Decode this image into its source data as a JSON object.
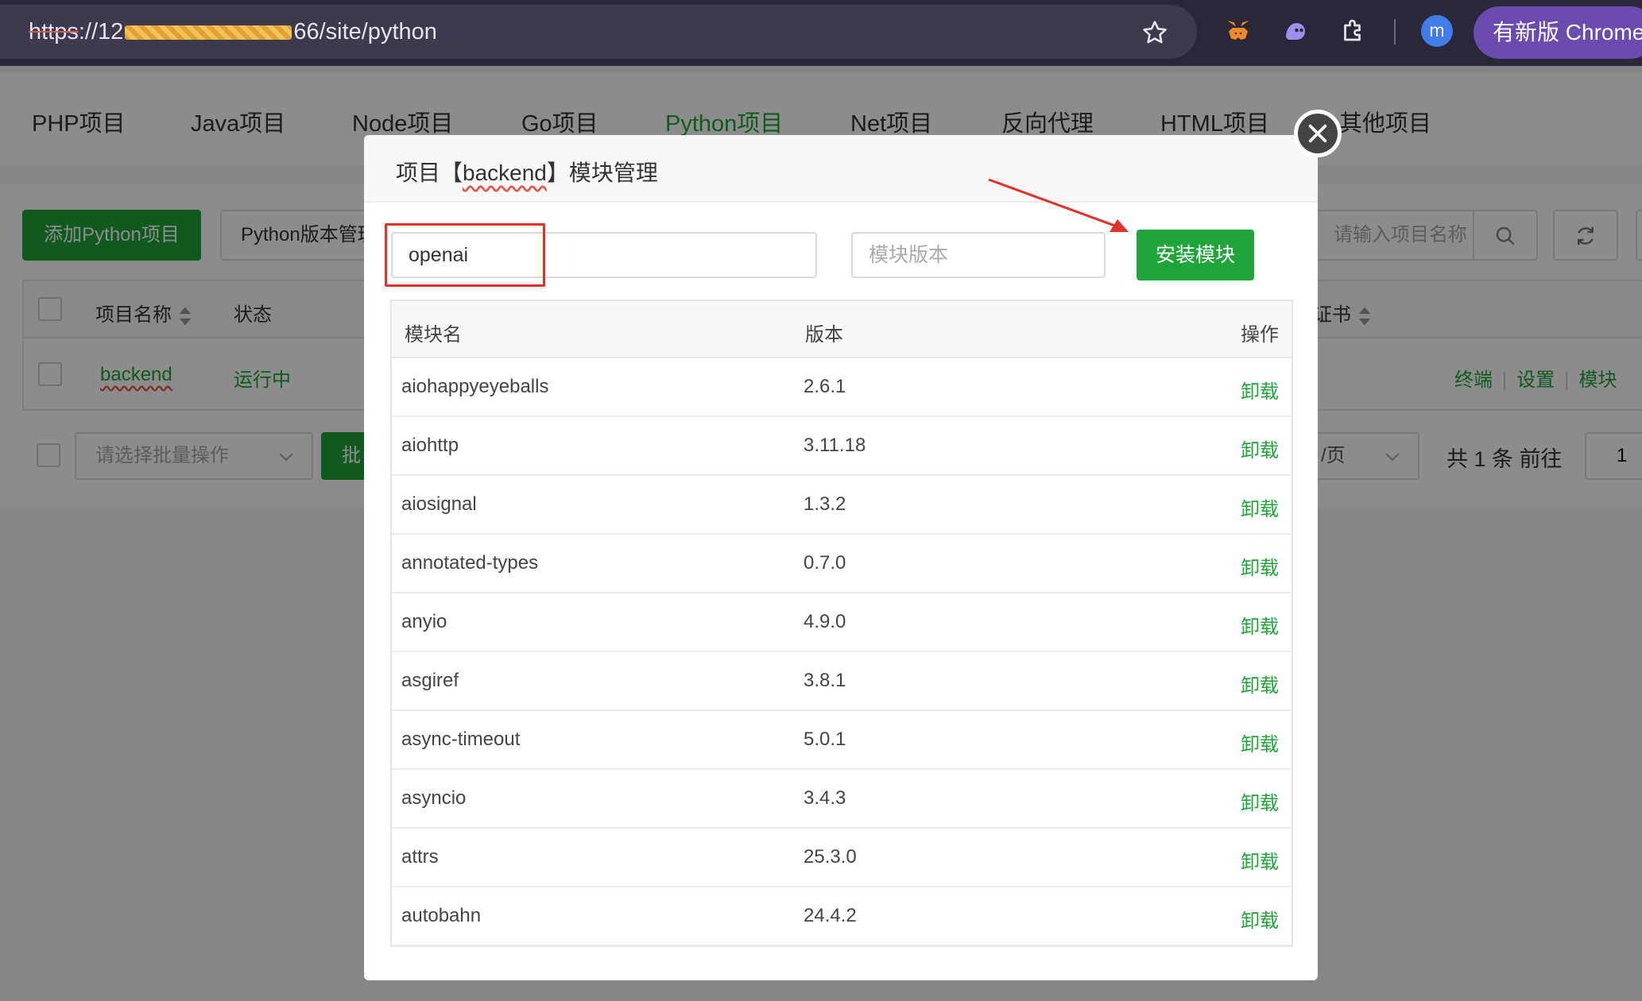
{
  "browser": {
    "url_scheme": "https",
    "url_prefix": "://12",
    "url_suffix": "66/site/python",
    "update_label": "有新版 Chrome",
    "avatar_letter": "m"
  },
  "app": {
    "tabs": [
      "PHP项目",
      "Java项目",
      "Node项目",
      "Go项目",
      "Python项目",
      "Net项目",
      "反向代理",
      "HTML项目",
      "其他项目"
    ],
    "active_tab": "Python项目",
    "add_button": "添加Python项目",
    "pyver_button": "Python版本管理",
    "search_placeholder": "请输入项目名称",
    "table": {
      "col_name": "项目名称",
      "col_status": "状态",
      "col_cert": "证书",
      "row_name": "backend",
      "row_status": "运行中",
      "ops": [
        "终端",
        "设置",
        "模块"
      ]
    },
    "batch_placeholder": "请选择批量操作",
    "batch_button": "批量",
    "page_size": "/页",
    "page_total": "共 1 条  前往",
    "page_goto": "1"
  },
  "modal": {
    "title_prefix": "项目【",
    "title_project": "backend",
    "title_suffix": "】模块管理",
    "module_input_value": "openai",
    "version_placeholder": "模块版本",
    "install_button": "安装模块",
    "columns": {
      "name": "模块名",
      "version": "版本",
      "action": "操作"
    },
    "uninstall_label": "卸载",
    "rows": [
      {
        "name": "aiohappyeyeballs",
        "version": "2.6.1"
      },
      {
        "name": "aiohttp",
        "version": "3.11.18"
      },
      {
        "name": "aiosignal",
        "version": "1.3.2"
      },
      {
        "name": "annotated-types",
        "version": "0.7.0"
      },
      {
        "name": "anyio",
        "version": "4.9.0"
      },
      {
        "name": "asgiref",
        "version": "3.8.1"
      },
      {
        "name": "async-timeout",
        "version": "5.0.1"
      },
      {
        "name": "asyncio",
        "version": "3.4.3"
      },
      {
        "name": "attrs",
        "version": "25.3.0"
      },
      {
        "name": "autobahn",
        "version": "24.4.2"
      }
    ]
  },
  "colors": {
    "accent_green": "#20a53a",
    "annotation_red": "#e0312b",
    "browser_bg": "#2a2838"
  }
}
